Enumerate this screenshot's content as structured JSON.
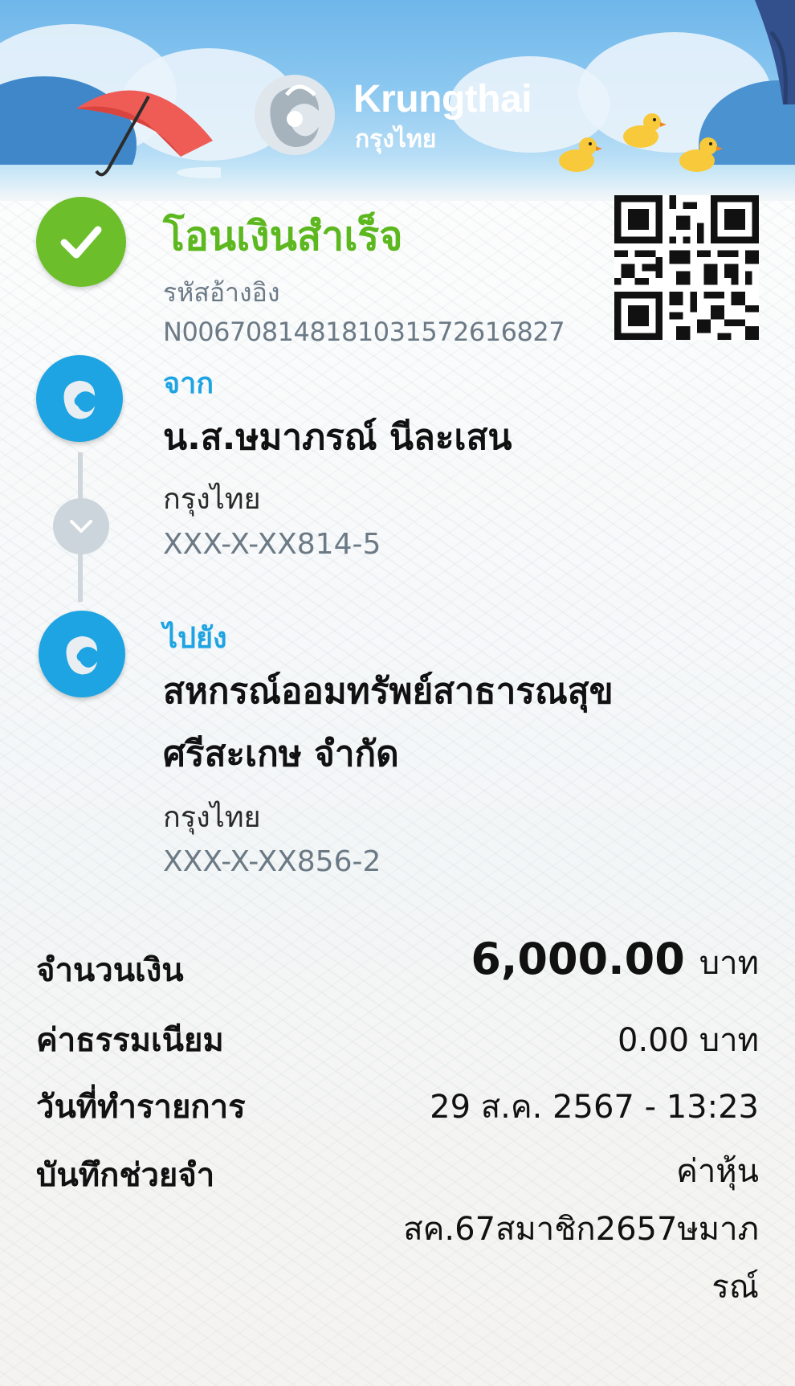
{
  "brand": {
    "name_en": "Krungthai",
    "name_th": "กรุงไทย"
  },
  "status": {
    "title": "โอนเงินสำเร็จ",
    "ref_label": "รหัสอ้างอิง",
    "ref_value": "N006708148181031572616827"
  },
  "from": {
    "label": "จาก",
    "name": "น.ส.ษมาภรณ์ นีละเสน",
    "bank": "กรุงไทย",
    "account": "XXX-X-XX814-5"
  },
  "to": {
    "label": "ไปยัง",
    "name": "สหกรณ์ออมทรัพย์สาธารณสุขศรีสะเกษ จำกัด",
    "bank": "กรุงไทย",
    "account": "XXX-X-XX856-2"
  },
  "details": {
    "amount_label": "จำนวนเงิน",
    "amount_value": "6,000.00",
    "amount_unit": "บาท",
    "fee_label": "ค่าธรรมเนียม",
    "fee_value": "0.00 บาท",
    "date_label": "วันที่ทำรายการ",
    "date_value": "29 ส.ค. 2567 - 13:23",
    "memo_label": "บันทึกช่วยจำ",
    "memo_value": "ค่าหุ้น สค.67สมาชิก2657ษมาภรณ์"
  },
  "colors": {
    "success": "#6cbf2a",
    "accent": "#1ea4e2",
    "muted": "#6c7a86"
  },
  "icons": [
    "check-icon",
    "krungthai-logo",
    "qr-code",
    "chevron-down-icon",
    "umbrella-illustration",
    "duck-illustration"
  ]
}
